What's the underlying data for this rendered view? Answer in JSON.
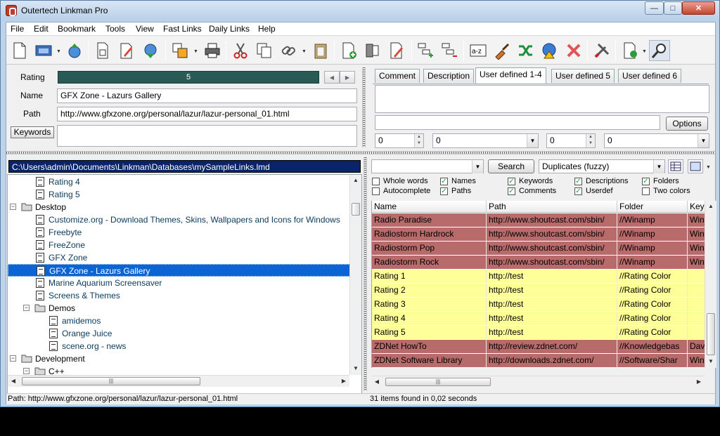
{
  "window": {
    "title": "Outertech Linkman Pro",
    "min_glyph": "—",
    "max_glyph": "□",
    "close_glyph": "✕"
  },
  "menu": [
    "File",
    "Edit",
    "Bookmark",
    "Tools",
    "View",
    "Fast Links",
    "Daily Links",
    "Help"
  ],
  "toolbar_icons": [
    "new-file-icon",
    "open-database-icon",
    "upload-icon",
    "print-preview-icon",
    "edit-icon",
    "download-icon",
    "bookmarks-icon",
    "print-icon",
    "cut-icon",
    "copy-icon",
    "link-icon",
    "paste-icon",
    "add-link-icon",
    "add-folder-icon",
    "edit-link-icon",
    "add-subfolder-icon",
    "remove-folder-icon",
    "sort-az-icon",
    "cleanup-icon",
    "shuffle-icon",
    "check-links-icon",
    "delete-icon",
    "tools-icon",
    "export-icon",
    "find-icon"
  ],
  "properties": {
    "rating_label": "Rating",
    "rating_value": "5",
    "rating_fraction": 1.0,
    "name_label": "Name",
    "name_value": "GFX Zone - Lazurs Gallery",
    "path_label": "Path",
    "path_value": "http://www.gfxzone.org/personal/lazur/lazur-personal_01.html",
    "keywords_button": "Keywords",
    "keywords_value": ""
  },
  "tabs": [
    "Comment",
    "Description",
    "User defined 1-4",
    "User defined 5",
    "User defined 6"
  ],
  "active_tab": "User defined 1-4",
  "user_defined": {
    "text1": "",
    "text2": "",
    "options_button": "Options",
    "num1": "0",
    "combo1": "0",
    "num2": "0",
    "combo2": "0"
  },
  "tree": {
    "db_path": "C:\\Users\\admin\\Documents\\Linkman\\Databases\\mySampleLinks.lmd",
    "items": [
      {
        "label": "Rating 4",
        "type": "link"
      },
      {
        "label": "Rating 5",
        "type": "link"
      },
      {
        "label": "Desktop",
        "type": "folder"
      },
      {
        "label": "Customize.org - Download Themes, Skins, Wallpapers and Icons for Windows",
        "type": "link"
      },
      {
        "label": "Freebyte",
        "type": "link"
      },
      {
        "label": "FreeZone",
        "type": "link"
      },
      {
        "label": "GFX Zone",
        "type": "link"
      },
      {
        "label": "GFX Zone - Lazurs Gallery",
        "type": "link"
      },
      {
        "label": "Marine Aquarium Screensaver",
        "type": "link"
      },
      {
        "label": "Screens & Themes",
        "type": "link"
      },
      {
        "label": "Demos",
        "type": "folder"
      },
      {
        "label": "amidemos",
        "type": "link"
      },
      {
        "label": "Orange Juice",
        "type": "link"
      },
      {
        "label": "scene.org - news",
        "type": "link"
      },
      {
        "label": "Development",
        "type": "folder"
      },
      {
        "label": "C++",
        "type": "folder"
      }
    ]
  },
  "search": {
    "query": "",
    "button": "Search",
    "mode": "Duplicates (fuzzy)",
    "checkboxes": [
      {
        "label": "Whole words",
        "checked": false
      },
      {
        "label": "Autocomplete",
        "checked": false
      },
      {
        "label": "Names",
        "checked": true
      },
      {
        "label": "Paths",
        "checked": true
      },
      {
        "label": "Keywords",
        "checked": true
      },
      {
        "label": "Comments",
        "checked": true
      },
      {
        "label": "Descriptions",
        "checked": true
      },
      {
        "label": "Userdef",
        "checked": true
      },
      {
        "label": "Folders",
        "checked": true
      },
      {
        "label": "Two colors",
        "checked": false
      }
    ]
  },
  "results": {
    "columns": [
      "Name",
      "Path",
      "Folder",
      "Key"
    ],
    "rows": [
      {
        "name": "Radio Paradise",
        "path": "http://www.shoutcast.com/sbin/",
        "folder": "//Winamp",
        "key": "Win",
        "color": "#b86b6b"
      },
      {
        "name": "Radiostorm Hardrock",
        "path": "http://www.shoutcast.com/sbin/",
        "folder": "//Winamp",
        "key": "Win",
        "color": "#b86b6b"
      },
      {
        "name": "Radiostorm Pop",
        "path": "http://www.shoutcast.com/sbin/",
        "folder": "//Winamp",
        "key": "Win",
        "color": "#b86b6b"
      },
      {
        "name": "Radiostorm Rock",
        "path": "http://www.shoutcast.com/sbin/",
        "folder": "//Winamp",
        "key": "Win",
        "color": "#b86b6b"
      },
      {
        "name": "Rating 1",
        "path": "http://test",
        "folder": "//Rating Color",
        "key": "",
        "color": "#ffff99"
      },
      {
        "name": "Rating 2",
        "path": "http://test",
        "folder": "//Rating Color",
        "key": "",
        "color": "#ffff99"
      },
      {
        "name": "Rating 3",
        "path": "http://test",
        "folder": "//Rating Color",
        "key": "",
        "color": "#ffff99"
      },
      {
        "name": "Rating 4",
        "path": "http://test",
        "folder": "//Rating Color",
        "key": "",
        "color": "#ffff99"
      },
      {
        "name": "Rating 5",
        "path": "http://test",
        "folder": "//Rating Color",
        "key": "",
        "color": "#ffff99"
      },
      {
        "name": "ZDNet HowTo",
        "path": "http://review.zdnet.com/",
        "folder": "//Knowledgebas",
        "key": "Dav",
        "color": "#b86b6b"
      },
      {
        "name": "ZDNet Software Library",
        "path": "http://downloads.zdnet.com/",
        "folder": "//Software/Shar",
        "key": "Win",
        "color": "#b86b6b"
      }
    ]
  },
  "status": {
    "left": "Path: http://www.gfxzone.org/personal/lazur/lazur-personal_01.html",
    "right": "31 items found in 0,02 seconds"
  },
  "colors": {
    "selection": "#0a64d4",
    "rating_bar": "#2a5a55",
    "dup_row": "#b86b6b",
    "rating_row": "#ffff99"
  }
}
